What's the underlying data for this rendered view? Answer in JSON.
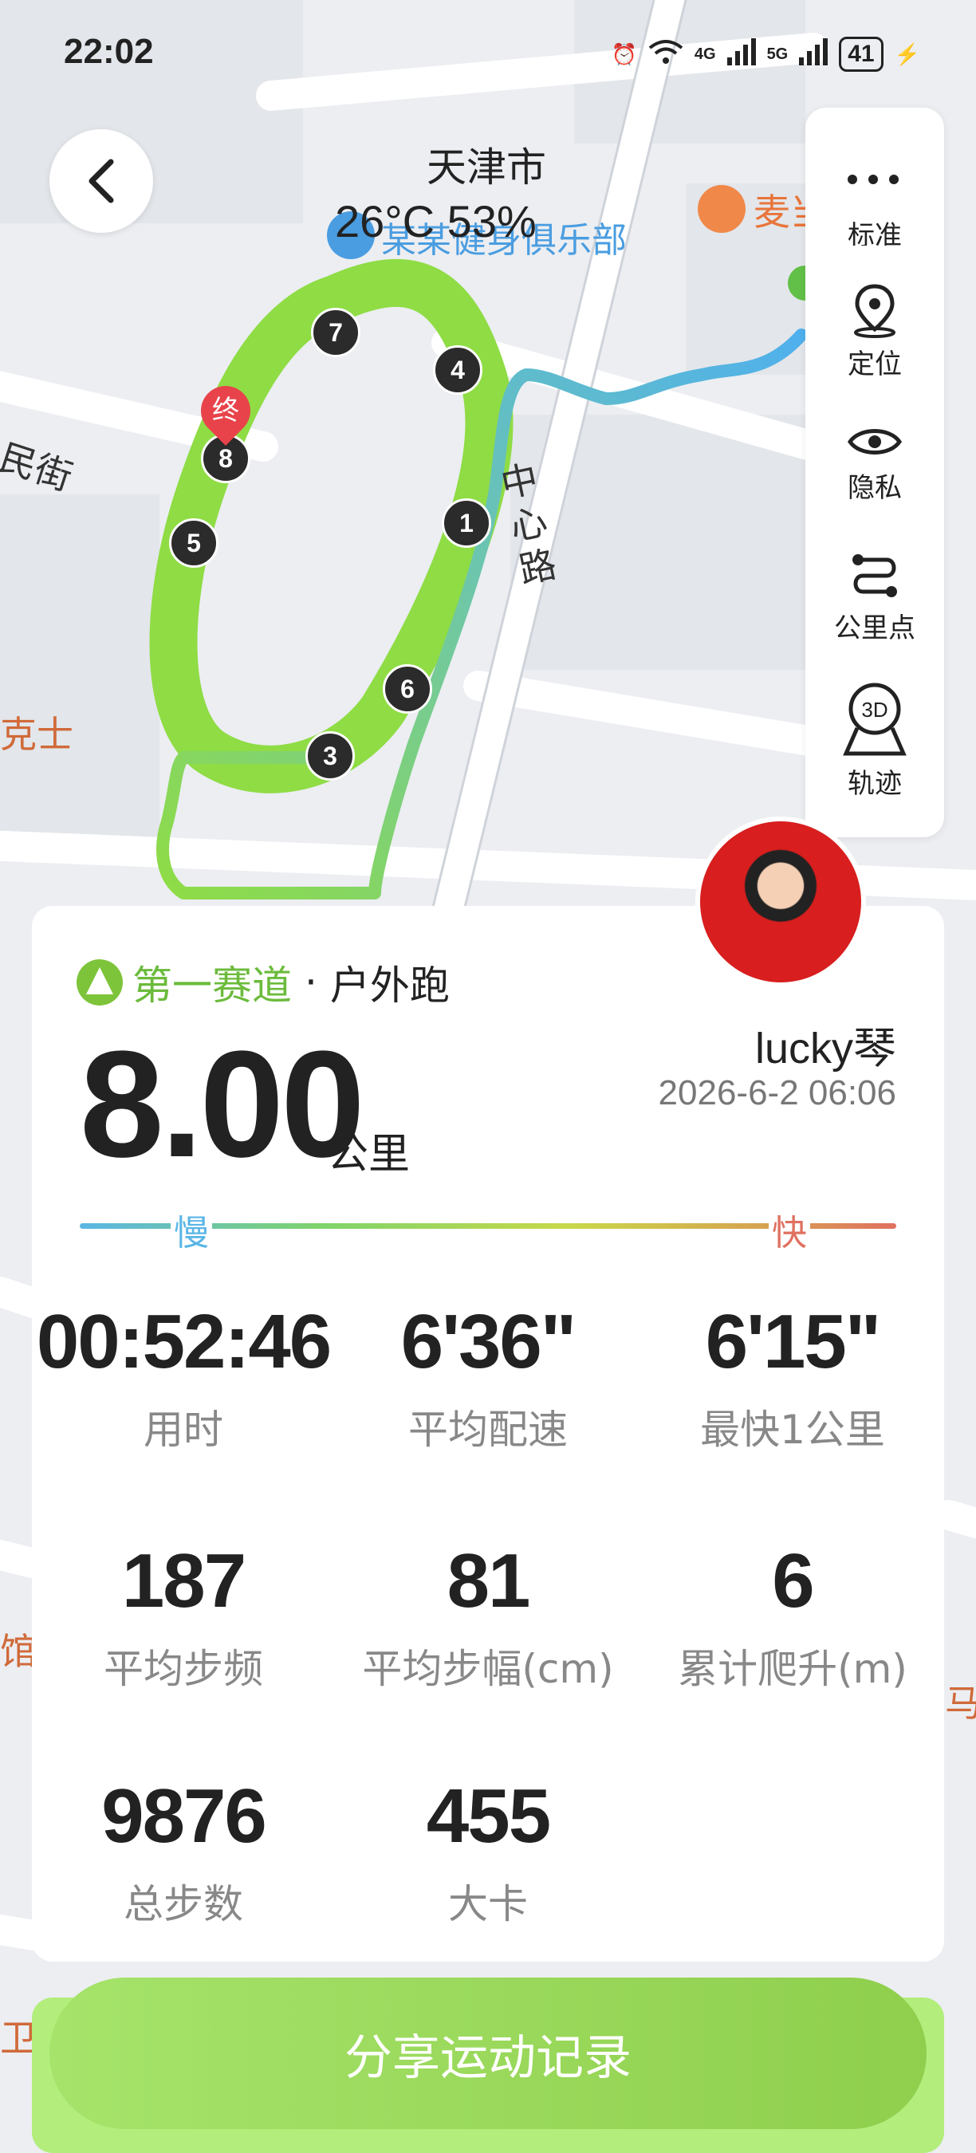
{
  "status_bar": {
    "time": "22:02",
    "network_1": "4G",
    "network_2": "5G",
    "battery": "41"
  },
  "map": {
    "city": "天津市",
    "weather": "26°C 53%",
    "poi_club": "某某健身俱乐部",
    "poi_food": "麦当",
    "road_label": "中心路",
    "street_left": "民街",
    "poi_left": "克士",
    "poi_left_lower": "馆",
    "poi_right_lower": "马",
    "poi_bottom_left": "卫",
    "end_marker": "终",
    "km_markers": [
      "1",
      "3",
      "4",
      "5",
      "6",
      "7",
      "8"
    ]
  },
  "map_tools": {
    "more": "more",
    "partial_label": "标准",
    "items": [
      {
        "label": "定位",
        "icon": "location-pin-icon"
      },
      {
        "label": "隐私",
        "icon": "eye-icon"
      },
      {
        "label": "公里点",
        "icon": "route-icon"
      },
      {
        "label": "轨迹",
        "icon": "3d-pin-icon"
      }
    ]
  },
  "summary": {
    "brand": "第一赛道",
    "separator": "·",
    "activity_type": "户外跑",
    "distance": "8.00",
    "distance_unit": "公里",
    "username": "lucky琴",
    "datetime": "2026-6-2 06:06",
    "pace_slow": "慢",
    "pace_fast": "快"
  },
  "stats": [
    {
      "value": "00:52:46",
      "label": "用时"
    },
    {
      "value": "6'36\"",
      "label": "平均配速"
    },
    {
      "value": "6'15\"",
      "label": "最快1公里"
    },
    {
      "value": "187",
      "label": "平均步频"
    },
    {
      "value": "81",
      "label": "平均步幅(cm)"
    },
    {
      "value": "6",
      "label": "累计爬升(m)"
    },
    {
      "value": "9876",
      "label": "总步数"
    },
    {
      "value": "455",
      "label": "大卡"
    }
  ],
  "share_button": "分享运动记录",
  "colors": {
    "track_green": "#8fdc45",
    "route_blue": "#5ab6e6",
    "brand_green": "#6cbb3c"
  }
}
